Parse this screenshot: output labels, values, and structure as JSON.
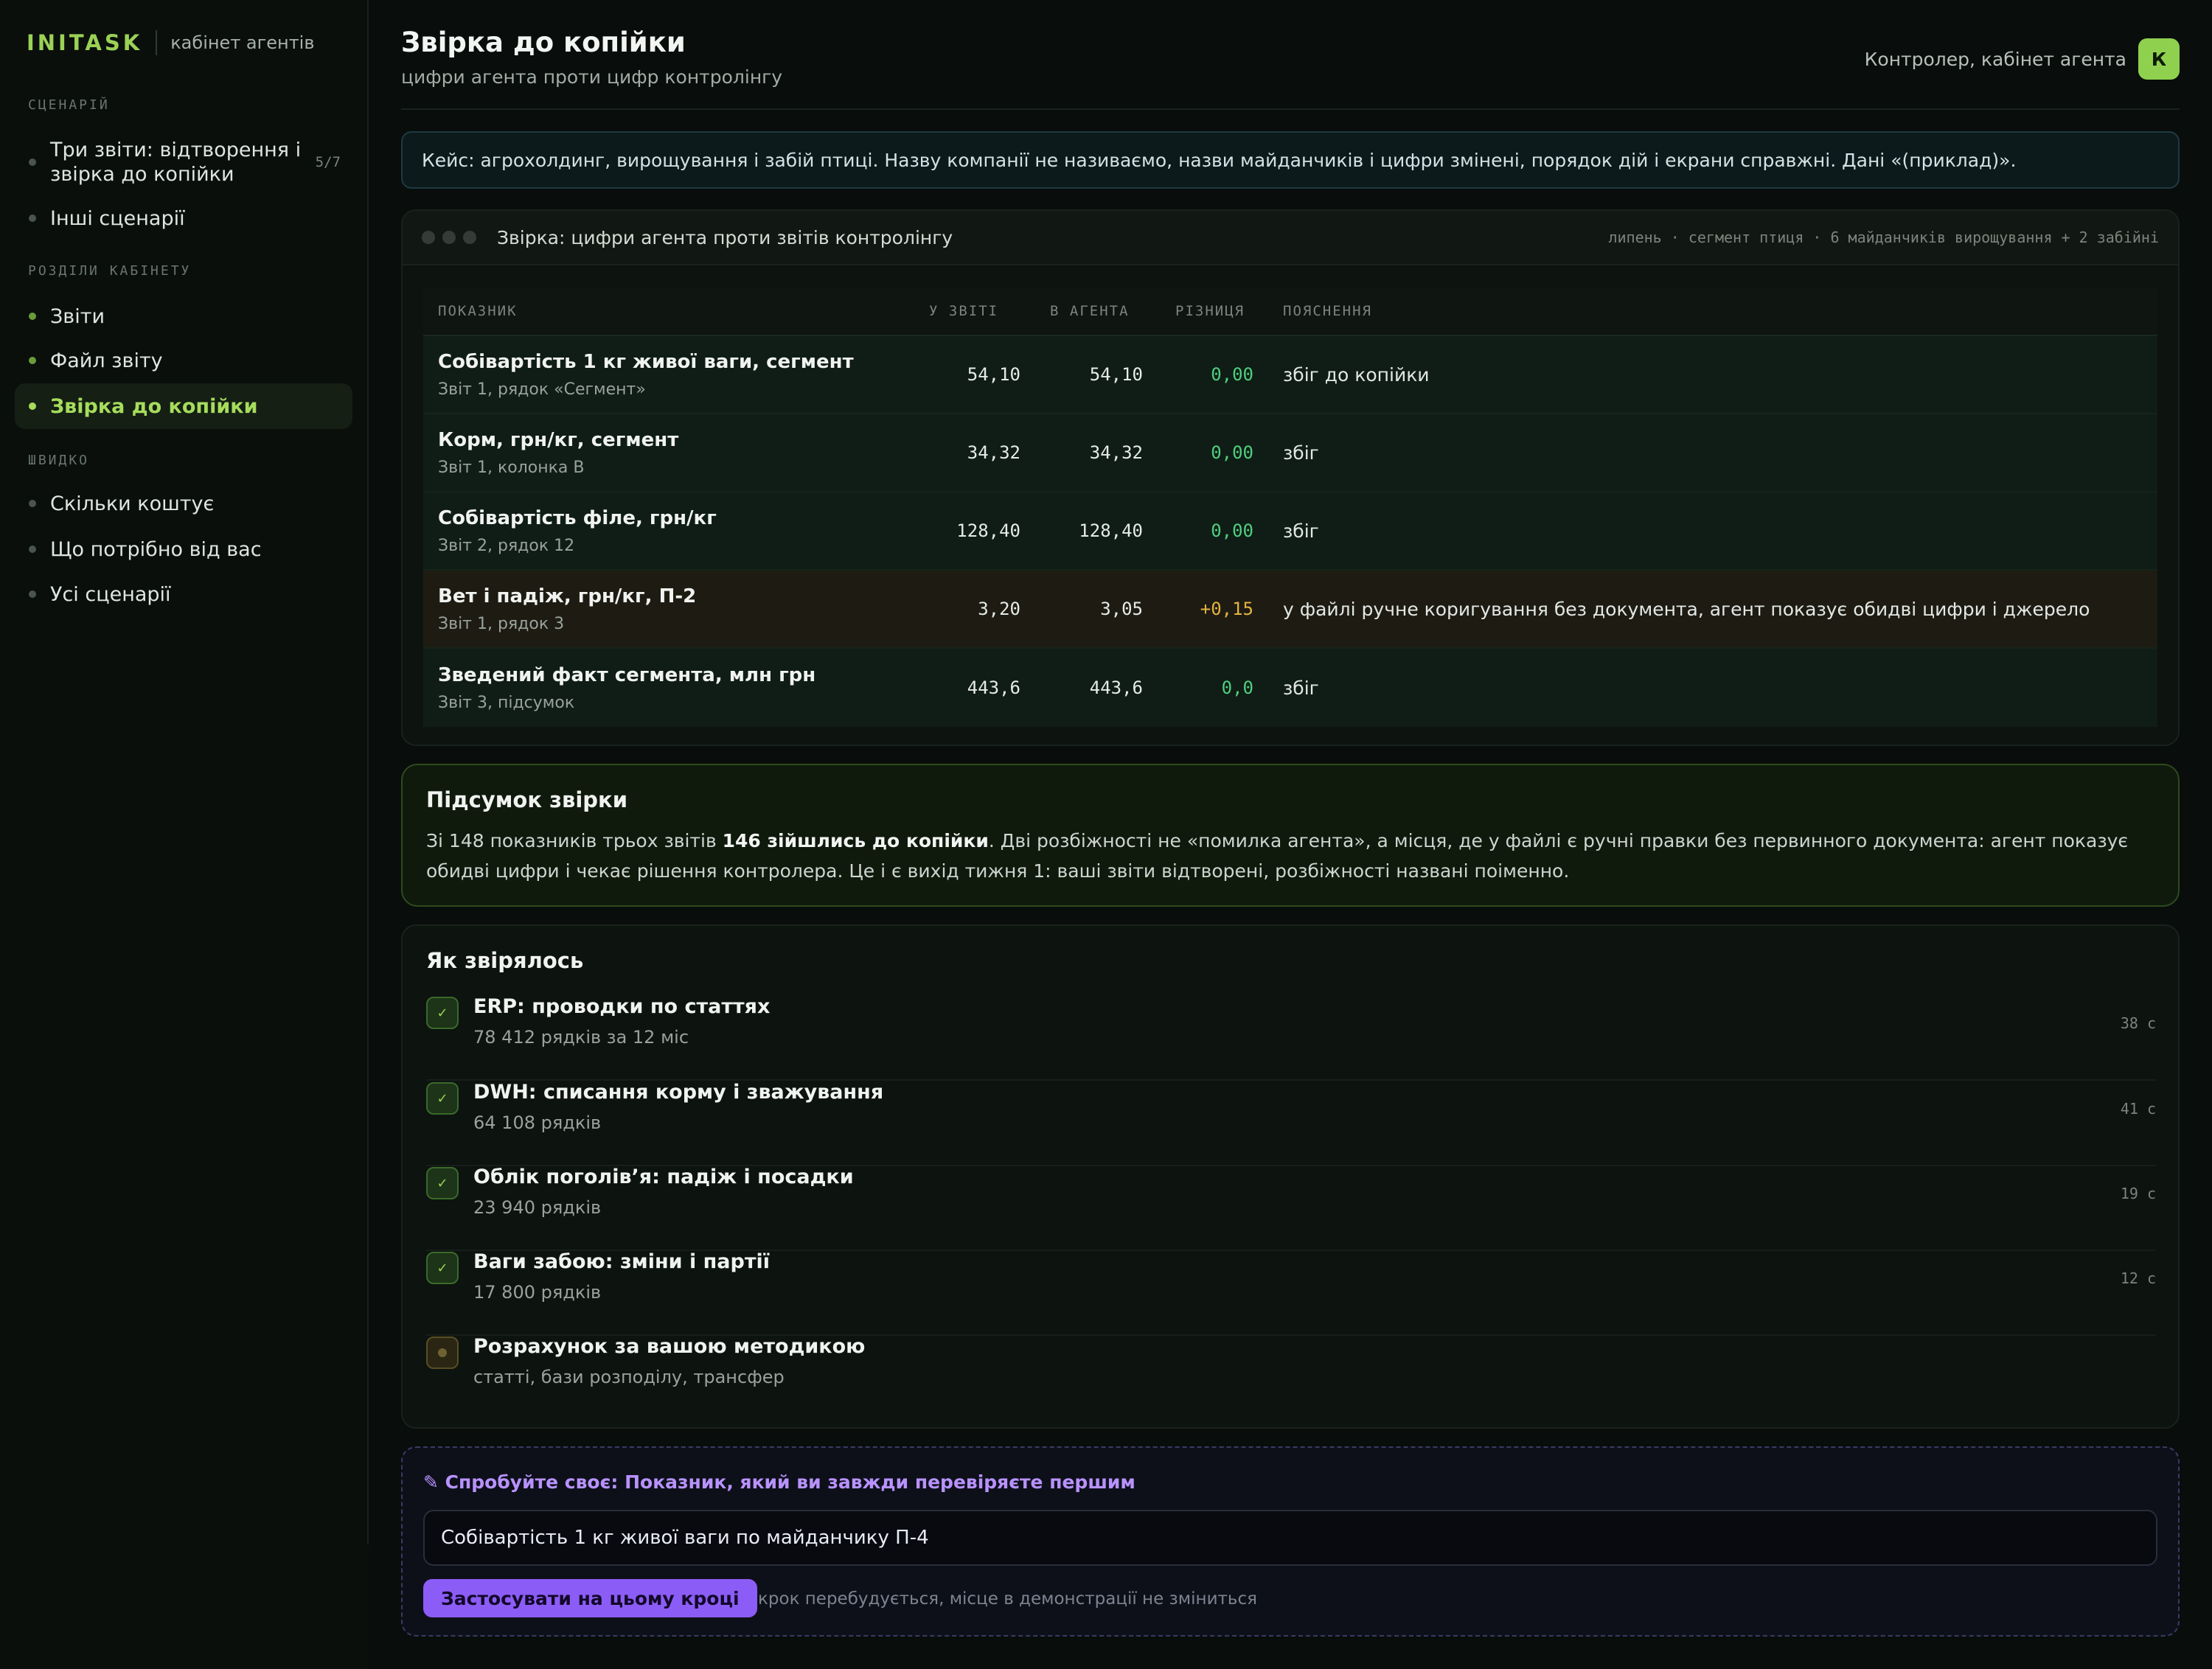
{
  "brand": {
    "logo": "INITASK",
    "subtitle": "кабінет агентів"
  },
  "sidebar": {
    "sections": [
      {
        "title": "СЦЕНАРІЙ"
      },
      {
        "title": "РОЗДІЛИ КАБІНЕТУ"
      },
      {
        "title": "ШВИДКО"
      }
    ],
    "scenario_items": [
      {
        "label": "Три звіти: відтворення і звірка до копійки",
        "count": "5/7"
      },
      {
        "label": "Інші сценарії"
      }
    ],
    "cabinet_items": [
      {
        "label": "Звіти"
      },
      {
        "label": "Файл звіту"
      },
      {
        "label": "Звірка до копійки"
      }
    ],
    "quick_items": [
      {
        "label": "Скільки коштує"
      },
      {
        "label": "Що потрібно від вас"
      },
      {
        "label": "Усі сценарії"
      }
    ]
  },
  "header": {
    "title": "Звірка до копійки",
    "subtitle": "цифри агента проти цифр контролінгу",
    "role": "Контролер, кабінет агента",
    "avatar": "К"
  },
  "case_banner": "Кейс: агрохолдинг, вирощування і забій птиці. Назву компанії не називаємо, назви майданчиків і цифри змінені, порядок дій і екрани справжні. Дані «(приклад)».",
  "recon": {
    "title": "Звірка: цифри агента проти звітів контролінгу",
    "meta": "липень · сегмент птиця · 6 майданчиків вирощування + 2 забійні",
    "columns": {
      "name": "ПОКАЗНИК",
      "report": "У ЗВІТІ",
      "agent": "В АГЕНТА",
      "diff": "РІЗНИЦЯ",
      "note": "ПОЯСНЕННЯ"
    },
    "rows": [
      {
        "name": "Собівартість 1 кг живої ваги, сегмент",
        "source": "Звіт 1, рядок «Сегмент»",
        "report": "54,10",
        "agent": "54,10",
        "diff": "0,00",
        "note": "збіг до копійки"
      },
      {
        "name": "Корм, грн/кг, сегмент",
        "source": "Звіт 1, колонка B",
        "report": "34,32",
        "agent": "34,32",
        "diff": "0,00",
        "note": "збіг"
      },
      {
        "name": "Собівартість філе, грн/кг",
        "source": "Звіт 2, рядок 12",
        "report": "128,40",
        "agent": "128,40",
        "diff": "0,00",
        "note": "збіг"
      },
      {
        "name": "Вет і падіж, грн/кг, П-2",
        "source": "Звіт 1, рядок 3",
        "report": "3,20",
        "agent": "3,05",
        "diff": "+0,15",
        "note": "у файлі ручне коригування без документа, агент показує обидві цифри і джерело"
      },
      {
        "name": "Зведений факт сегмента, млн грн",
        "source": "Звіт 3, підсумок",
        "report": "443,6",
        "agent": "443,6",
        "diff": "0,0",
        "note": "збіг"
      }
    ]
  },
  "summary": {
    "title": "Підсумок звірки",
    "text_before": "Зі 148 показників трьох звітів ",
    "text_bold": "146 зійшлись до копійки",
    "text_after": ". Дві розбіжності не «помилка агента», а місця, де у файлі є ручні правки без первинного документа: агент показує обидві цифри і чекає рішення контролера. Це і є вихід тижня 1: ваші звіти відтворені, розбіжності названі поіменно."
  },
  "steps": {
    "title": "Як звірялось",
    "items": [
      {
        "title": "ERP: проводки по статтях",
        "sub": "78 412 рядків за 12 міс",
        "time": "38 с",
        "check": "✓"
      },
      {
        "title": "DWH: списання корму і зважування",
        "sub": "64 108 рядків",
        "time": "41 с",
        "check": "✓"
      },
      {
        "title": "Облік поголів’я: падіж і посадки",
        "sub": "23 940 рядків",
        "time": "19 с",
        "check": "✓"
      },
      {
        "title": "Ваги забою: зміни і партії",
        "sub": "17 800 рядків",
        "time": "12 с",
        "check": "✓"
      },
      {
        "title": "Розрахунок за вашою методикою",
        "sub": "статті, бази розподілу, трансфер",
        "time": ""
      }
    ]
  },
  "try": {
    "title": "✎ Спробуйте своє: Показник, який ви завжди перевіряєте першим",
    "input_value": "Собівартість 1 кг живої ваги по майданчику П-4",
    "button": "Застосувати на цьому кроці",
    "hint": "крок перебудується, місце в демонстрації не зміниться"
  }
}
